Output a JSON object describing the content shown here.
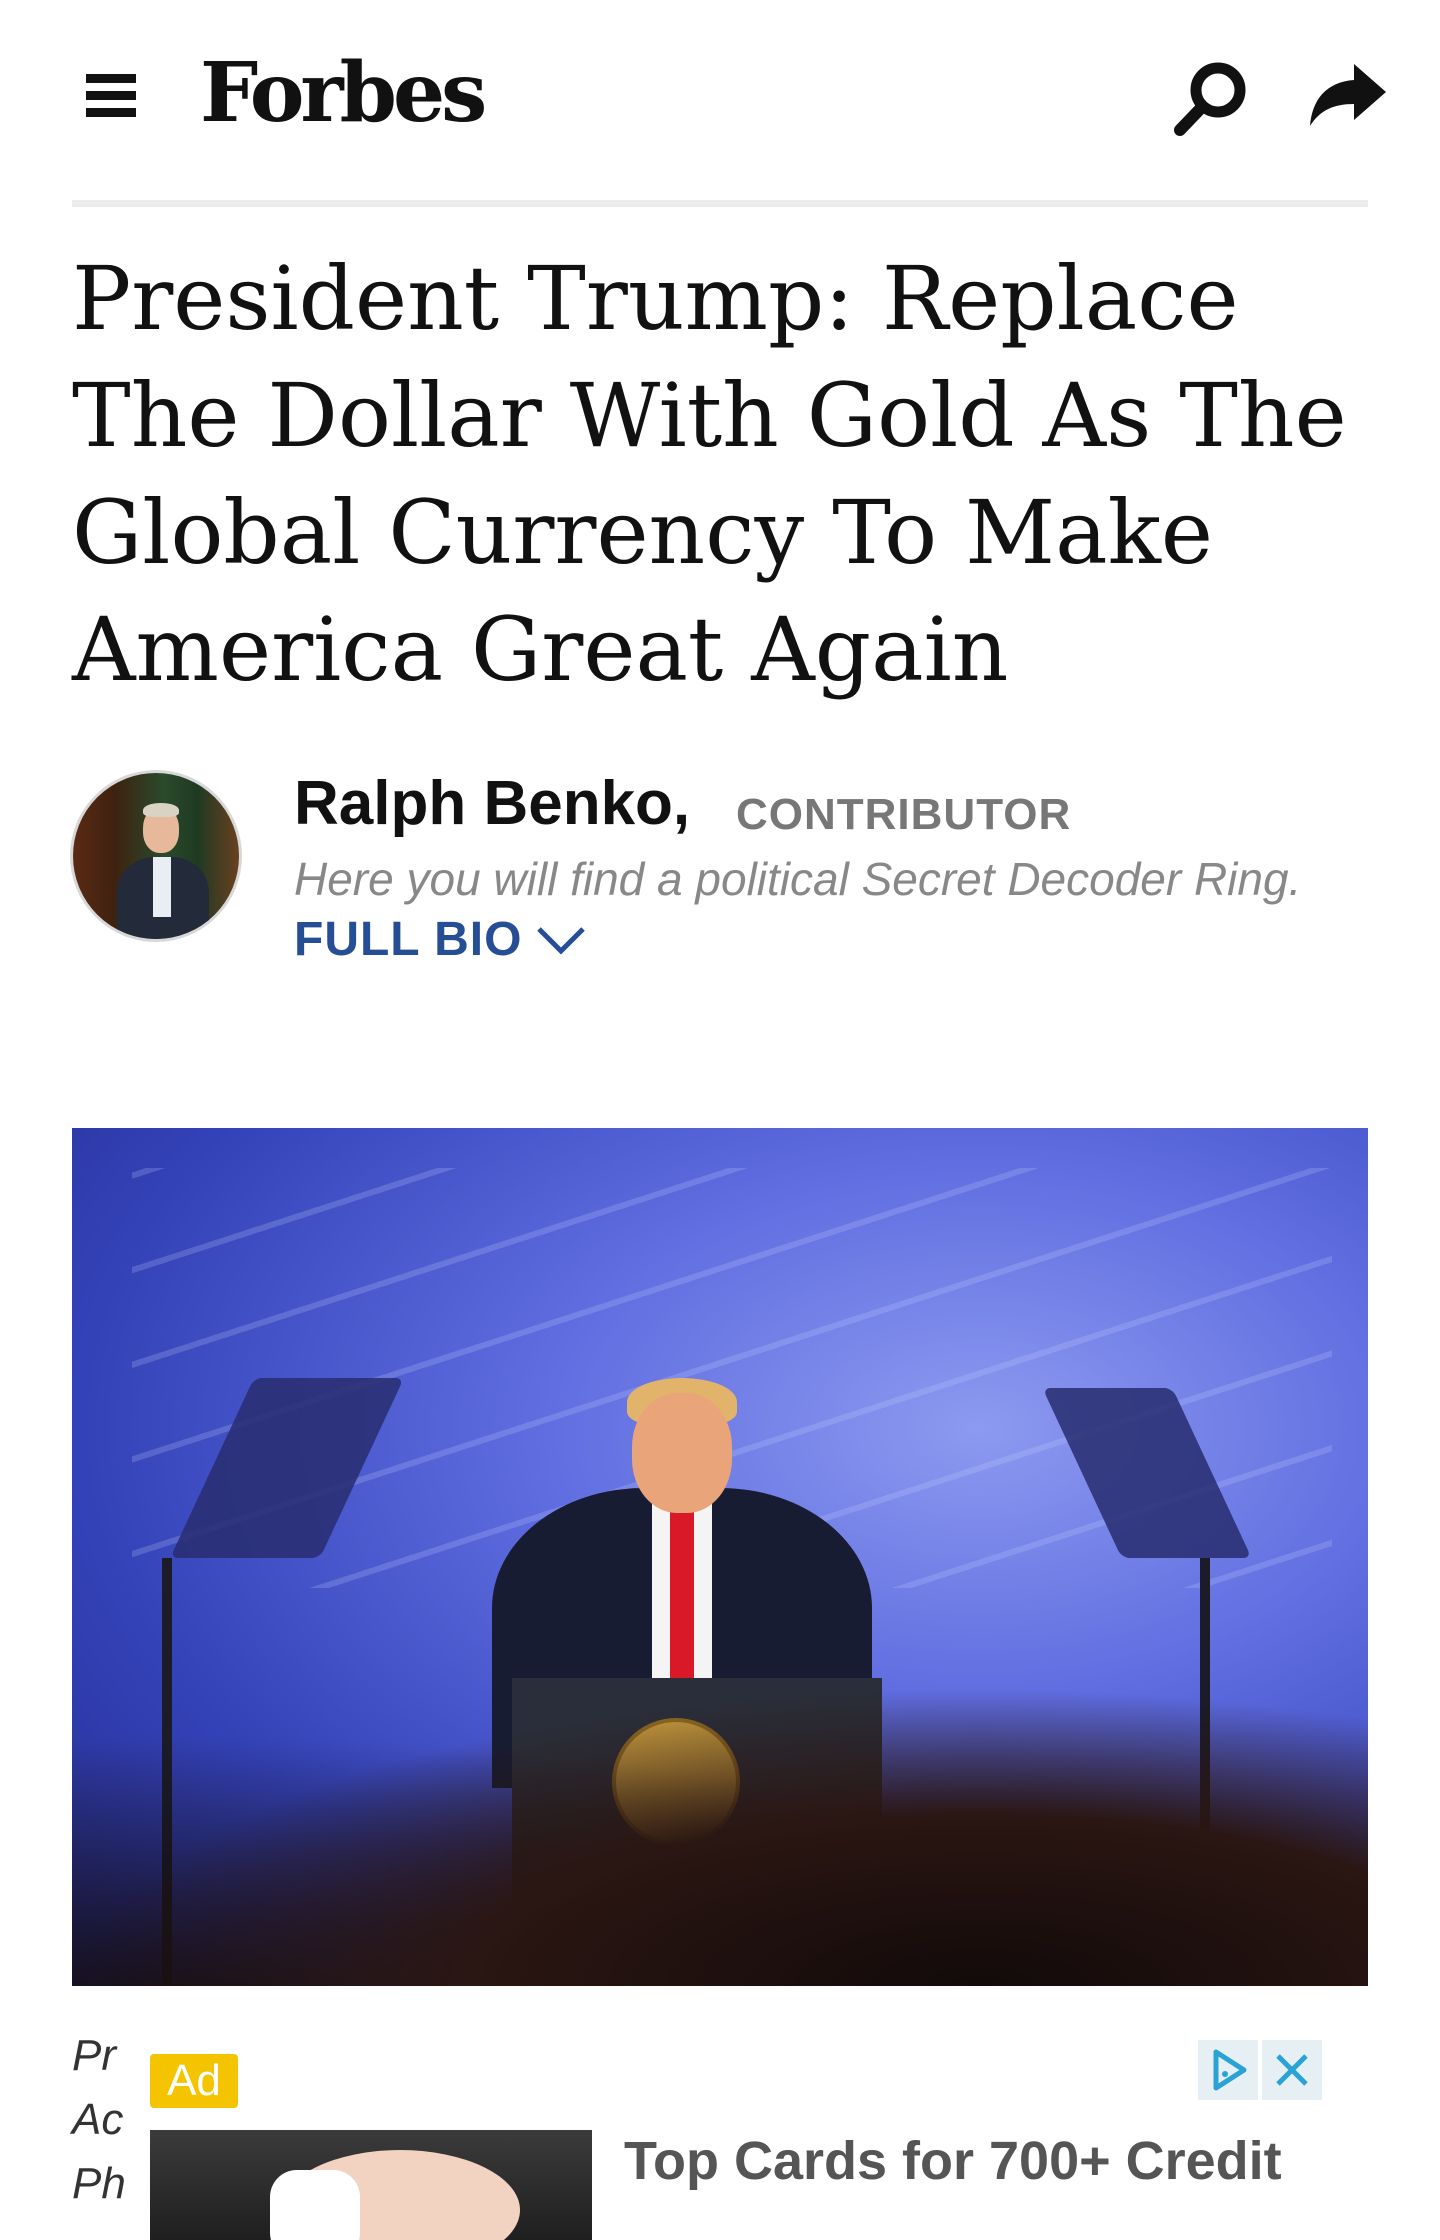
{
  "header": {
    "logo": "Forbes",
    "menu_icon": "hamburger-menu-icon",
    "search_icon": "search-icon",
    "share_icon": "share-arrow-icon"
  },
  "article": {
    "title": "President Trump: Replace The Dollar With Gold As The Global Currency To Make America Great Again",
    "author": {
      "name": "Ralph Benko,",
      "role": "CONTRIBUTOR",
      "tagline": "Here you will find a political Secret Decoder Ring.",
      "full_bio_label": "FULL BIO"
    },
    "caption_lines": [
      "Pr",
      "Ac",
      "Ph"
    ]
  },
  "ad": {
    "badge": "Ad",
    "headline": "Top Cards for 700+ Credit",
    "choices_icon": "ad-choices-icon",
    "close_icon": "close-icon"
  },
  "colors": {
    "link_blue": "#264e94",
    "ad_badge": "#f4c400",
    "ad_icon": "#29a3d6"
  }
}
